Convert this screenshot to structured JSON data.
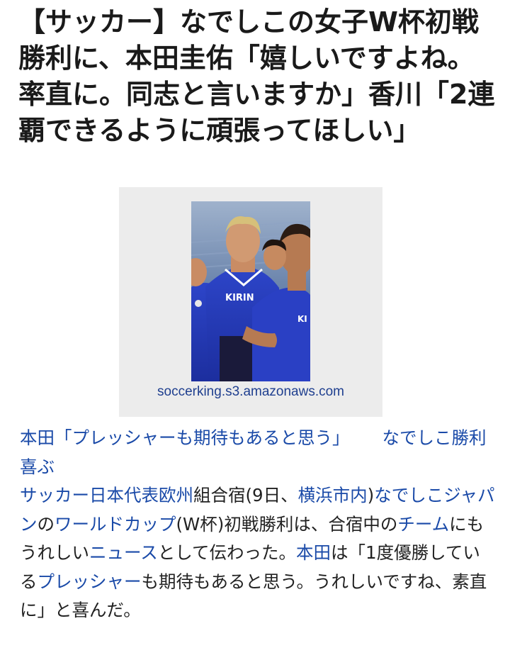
{
  "article": {
    "headline": "【サッカー】なでしこの女子W杯初戦勝利に、本田圭佑「嬉しいですよね。率直に。同志と言いますか」香川「2連覇できるように頑張ってほしい」",
    "image": {
      "caption": "soccerking.s3.amazonaws.com",
      "jersey_text": "KIRIN"
    },
    "related": {
      "link1": "本田「プレッシャーも期待もあると思う」",
      "link2": "なでしこ勝利喜ぶ"
    },
    "body": {
      "l1": "サッカー日本代表欧州",
      "t1": "組合宿(9日、",
      "l2": "横浜市内",
      "t2": ")",
      "l3": "なでしこジャパン",
      "t3": "の",
      "l4": "ワールドカップ",
      "t4": "(W杯)初戦勝利は、合宿中の",
      "l5": "チーム",
      "t5": "にもうれしい",
      "l6": "ニュース",
      "t6": "として伝わった。",
      "l7": "本田",
      "t7": "は「1度優勝している",
      "l8": "プレッシャー",
      "t8": "も期待もあると思う。うれしいですね、素直に」と喜んだ。"
    }
  },
  "colors": {
    "link": "#1a4aa8",
    "caption": "#1f3f8f",
    "text": "#222222",
    "figure_bg": "#ececec"
  }
}
